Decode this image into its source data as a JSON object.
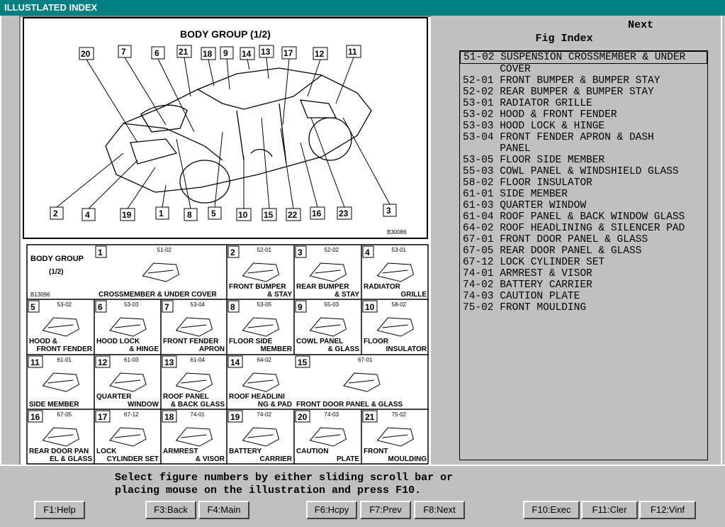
{
  "window": {
    "title": "ILLUSTLATED INDEX"
  },
  "illustration": {
    "title": "BODY GROUP (1/2)",
    "code": "B30086",
    "callouts": [
      "20",
      "7",
      "6",
      "21",
      "18",
      "9",
      "14",
      "13",
      "17",
      "12",
      "11",
      "2",
      "4",
      "19",
      "1",
      "8",
      "5",
      "10",
      "15",
      "22",
      "16",
      "23",
      "3"
    ]
  },
  "thumbnails": {
    "header_title": "BODY GROUP",
    "header_sub": "(1/2)",
    "header_code": "B13096",
    "cells": [
      {
        "num": "1",
        "code": "51-02",
        "label": "CROSSMEMBER & UNDER COVER"
      },
      {
        "num": "2",
        "code": "52-01",
        "label1": "FRONT BUMPER",
        "label2": "& STAY"
      },
      {
        "num": "3",
        "code": "52-02",
        "label1": "REAR BUMPER",
        "label2": "& STAY"
      },
      {
        "num": "4",
        "code": "53-01",
        "label1": "RADIATOR",
        "label2": "GRILLE"
      },
      {
        "num": "5",
        "code": "53-02",
        "label1": "HOOD &",
        "label2": "FRONT FENDER"
      },
      {
        "num": "6",
        "code": "53-03",
        "label1": "HOOD LOCK",
        "label2": "& HINGE"
      },
      {
        "num": "7",
        "code": "53-04",
        "label1": "FRONT FENDER",
        "label2": "APRON"
      },
      {
        "num": "8",
        "code": "53-05",
        "label1": "FLOOR SIDE",
        "label2": "MEMBER"
      },
      {
        "num": "9",
        "code": "55-03",
        "label1": "COWL PANEL",
        "label2": "& GLASS"
      },
      {
        "num": "10",
        "code": "58-02",
        "label1": "FLOOR",
        "label2": "INSULATOR"
      },
      {
        "num": "11",
        "code": "61-01",
        "label1": "SIDE MEMBER",
        "label2": ""
      },
      {
        "num": "12",
        "code": "61-03",
        "label1": "QUARTER",
        "label2": "WINDOW"
      },
      {
        "num": "13",
        "code": "61-04",
        "label1": "ROOF PANEL",
        "label2": "& BACK GLASS"
      },
      {
        "num": "14",
        "code": "64-02",
        "label1": "ROOF HEADLINI",
        "label2": "NG & PAD"
      },
      {
        "num": "15",
        "code": "67-01",
        "label1": "FRONT DOOR PANEL & GLASS",
        "label2": ""
      },
      {
        "num": "16",
        "code": "67-05",
        "label1": "REAR DOOR PAN",
        "label2": "EL & GLASS"
      },
      {
        "num": "17",
        "code": "67-12",
        "label1": "LOCK",
        "label2": "CYLINDER SET"
      },
      {
        "num": "18",
        "code": "74-01",
        "label1": "ARMREST",
        "label2": "& VISOR"
      },
      {
        "num": "19",
        "code": "74-02",
        "label1": "BATTERY",
        "label2": "CARRIER"
      },
      {
        "num": "20",
        "code": "74-03",
        "label1": "CAUTION",
        "label2": "PLATE"
      },
      {
        "num": "21",
        "code": "75-02",
        "label1": "FRONT",
        "label2": "MOULDING"
      }
    ]
  },
  "right_panel": {
    "next_label": "Next",
    "fig_index_label": "Fig Index",
    "items": [
      "51-02 SUSPENSION CROSSMEMBER & UNDER",
      "      COVER",
      "52-01 FRONT BUMPER & BUMPER STAY",
      "52-02 REAR BUMPER & BUMPER STAY",
      "53-01 RADIATOR GRILLE",
      "53-02 HOOD & FRONT FENDER",
      "53-03 HOOD LOCK & HINGE",
      "53-04 FRONT FENDER APRON & DASH",
      "      PANEL",
      "53-05 FLOOR SIDE MEMBER",
      "55-03 COWL PANEL & WINDSHIELD GLASS",
      "58-02 FLOOR INSULATOR",
      "61-01 SIDE MEMBER",
      "61-03 QUARTER WINDOW",
      "61-04 ROOF PANEL & BACK WINDOW GLASS",
      "64-02 ROOF HEADLINING & SILENCER PAD",
      "67-01 FRONT DOOR PANEL & GLASS",
      "67-05 REAR DOOR PANEL & GLASS",
      "67-12 LOCK CYLINDER SET",
      "74-01 ARMREST & VISOR",
      "74-02 BATTERY CARRIER",
      "74-03 CAUTION PLATE",
      "75-02 FRONT MOULDING"
    ]
  },
  "status": {
    "line1": "Select figure numbers by either sliding scroll bar or",
    "line2": "placing mouse on the illustration and press F10."
  },
  "buttons": {
    "f1": "F1:Help",
    "f3": "F3:Back",
    "f4": "F4:Main",
    "f6": "F6:Hcpy",
    "f7": "F7:Prev",
    "f8": "F8:Next",
    "f10": "F10:Exec",
    "f11": "F11:Cler",
    "f12": "F12:Vinf"
  }
}
